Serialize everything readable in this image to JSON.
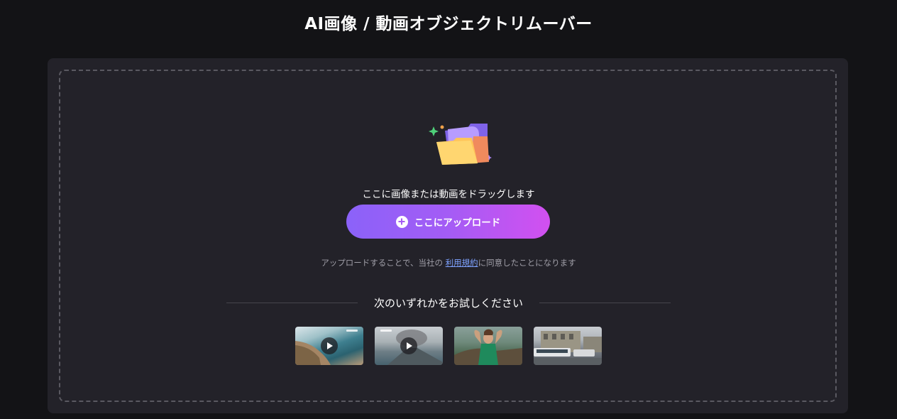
{
  "header": {
    "title": "AI画像 / 動画オブジェクトリムーバー"
  },
  "dropzone": {
    "drag_text": "ここに画像または動画をドラッグします",
    "upload_label": "ここにアップロード",
    "terms_prefix": "アップロードすることで、当社の ",
    "terms_link": "利用規約",
    "terms_suffix": "に同意したことになります"
  },
  "samples": {
    "heading": "次のいずれかをお試しください",
    "items": [
      {
        "kind": "video",
        "icon": "play-icon"
      },
      {
        "kind": "video",
        "icon": "play-icon"
      },
      {
        "kind": "image"
      },
      {
        "kind": "image"
      }
    ]
  },
  "colors": {
    "background": "#131316",
    "panel": "#232229",
    "button_gradient_start": "#8b62f9",
    "button_gradient_end": "#d250f0",
    "link": "#7ea2ff"
  }
}
